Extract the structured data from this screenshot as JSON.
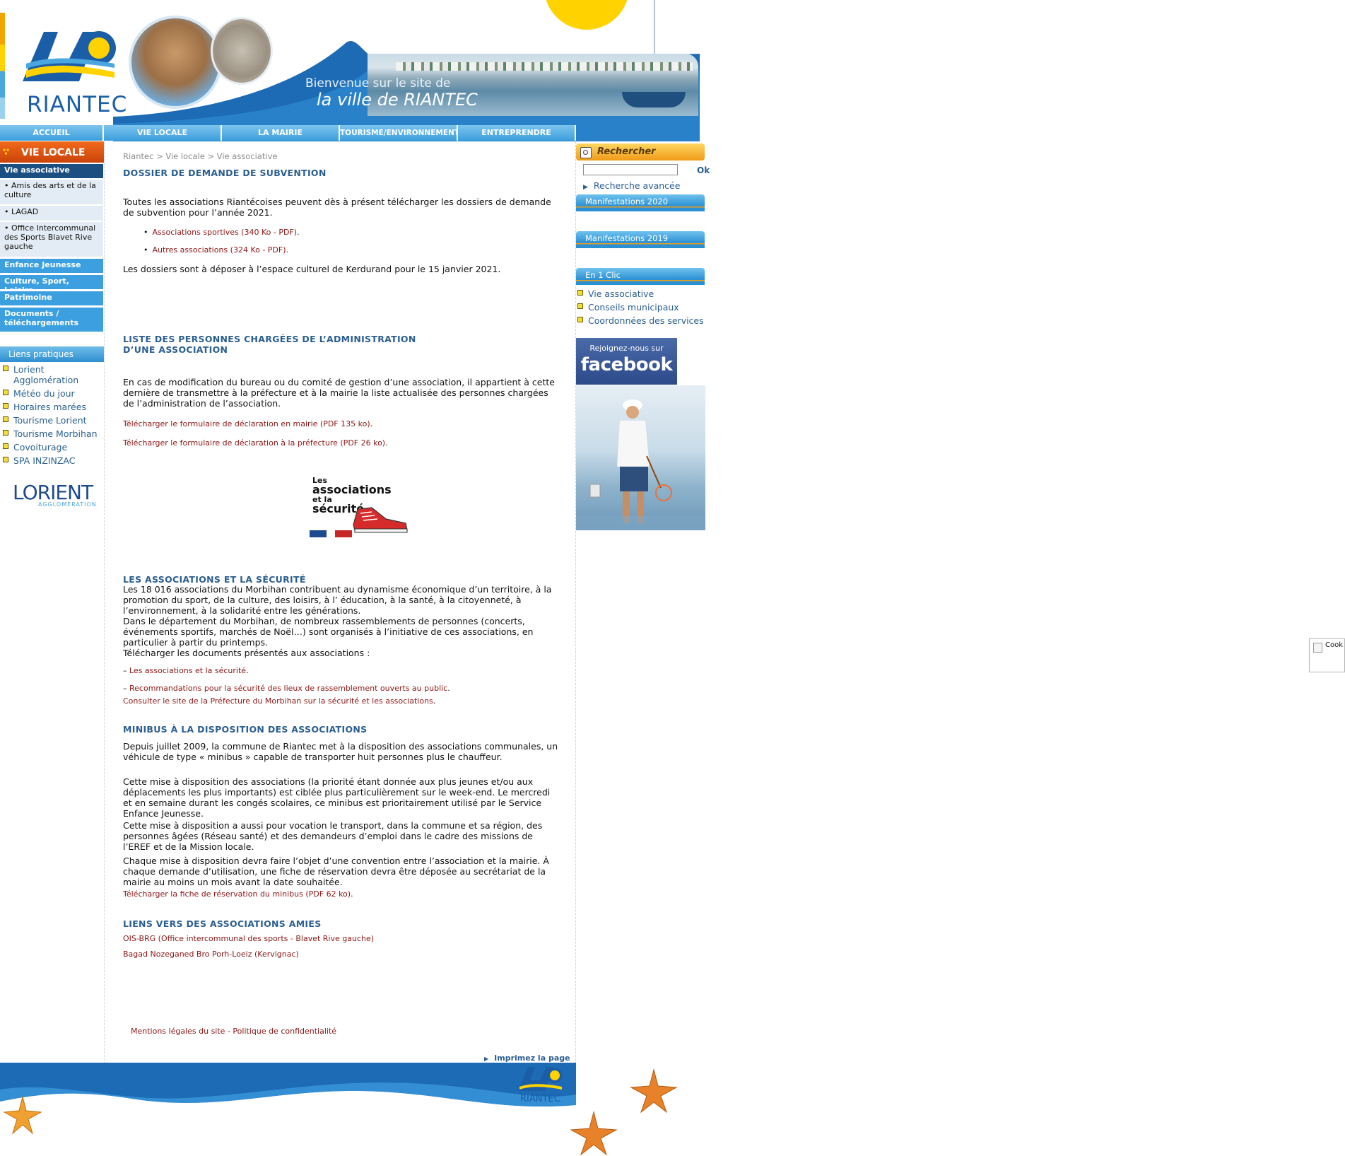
{
  "header": {
    "logo_text": "RIANTEC",
    "welcome_line1": "Bienvenue sur le site de",
    "welcome_line2": "la ville de RIANTEC"
  },
  "nav": {
    "items": [
      "ACCUEIL",
      "VIE LOCALE",
      "LA MAIRIE",
      "TOURISME/ENVIRONNEMENT",
      "ENTREPRENDRE"
    ]
  },
  "left": {
    "section_title": "VIE LOCALE",
    "active_item": "Vie associative",
    "sub_items": [
      "Amis des arts et de la culture",
      "LAGAD",
      "Office Intercommunal des Sports Blavet Rive gauche"
    ],
    "categories": [
      "Enfance Jeunesse",
      "Culture, Sport, Loisirs",
      "Patrimoine",
      "Documents / téléchargements"
    ],
    "liens_title": "Liens pratiques",
    "liens": [
      "Lorient Agglomération",
      "Météo du jour",
      "Horaires marées",
      "Tourisme Lorient",
      "Tourisme Morbihan",
      "Covoiturage",
      "SPA INZINZAC"
    ],
    "partner_logo": "LORIENT",
    "partner_logo_sub": "AGGLOMÉRATION"
  },
  "main": {
    "breadcrumb": "Riantec > Vie locale > Vie associative",
    "s1_title": "DOSSIER DE DEMANDE DE SUBVENTION",
    "s1_p1": "Toutes les associations Riantécoises peuvent dès à présent télécharger les dossiers de demande de subvention pour l’année 2021.",
    "s1_links": [
      "Associations sportives (340 Ko - PDF)",
      "Autres associations (324 Ko - PDF)"
    ],
    "s1_p2": "Les dossiers sont à déposer à l’espace culturel de Kerdurand pour le 15 janvier 2021.",
    "s2_title_l1": "LISTE DES PERSONNES CHARGÉES DE L’ADMINISTRATION",
    "s2_title_l2": "D’UNE ASSOCIATION",
    "s2_p1": "En cas de modification du bureau ou du comité de gestion d’une association, il appartient à cette dernière de transmettre à la préfecture et à la mairie la liste actualisée des personnes chargées de l’administration de l’association.",
    "s2_link1": "Télécharger le formulaire de déclaration en mairie (PDF 135 ko)",
    "s2_link2": "Télécharger le formulaire de déclaration à la préfecture (PDF 26 ko)",
    "secu_img_l1": "Les",
    "secu_img_l2": "associations",
    "secu_img_l3": "et la",
    "secu_img_l4": "sécurité",
    "s3_title": "LES ASSOCIATIONS ET LA SÉCURITÉ",
    "s3_p1": "Les 18 016 associations du Morbihan contribuent au dynamisme économique d’un territoire, à la promotion du sport, de la culture, des loisirs, à l’ éducation, à la santé, à la citoyenneté, à l’environnement, à la solidarité entre les générations.",
    "s3_p2": "Dans le département du Morbihan, de nombreux rassemblements de personnes (concerts, événements sportifs, marchés de Noël…) sont organisés à l’initiative de ces associations, en particulier à partir du printemps.",
    "s3_p3": "Télécharger les documents présentés aux associations :",
    "s3_link1": "Les associations et la sécurité",
    "s3_link2": "Recommandations pour la sécurité des lieux de rassemblement ouverts au public",
    "s3_link3": "Consulter le site de la Préfecture du Morbihan sur la sécurité et les associations",
    "s4_title": "MINIBUS À LA DISPOSITION DES ASSOCIATIONS",
    "s4_p1": "Depuis juillet 2009, la commune de Riantec met à la disposition des associations communales, un véhicule de type « minibus » capable de transporter huit personnes plus le chauffeur.",
    "s4_p2": "Cette mise à disposition des associations (la priorité étant donnée aux plus jeunes et/ou aux déplacements les plus importants) est ciblée plus particulièrement sur le week-end. Le mercredi et en semaine durant les congés scolaires, ce minibus est prioritairement utilisé par le Service Enfance Jeunesse.",
    "s4_p3": "Cette mise à disposition a aussi pour vocation le transport, dans la commune et sa région, des personnes âgées (Réseau santé) et des demandeurs d’emploi dans le cadre des missions de l’EREF et de la Mission locale.",
    "s4_p4": "Chaque mise à disposition devra faire l’objet d’une convention entre l’association et la mairie. À chaque demande d’utilisation, une fiche de réservation devra être déposée au secrétariat de la mairie au moins un mois avant la date souhaitée.",
    "s4_link1": "Télécharger la fiche de réservation du minibus (PDF 62 ko)",
    "s5_title": "LIENS VERS DES ASSOCIATIONS AMIES",
    "s5_link1": "OIS-BRG (Office intercommunal des sports - Blavet Rive gauche)",
    "s5_link2": "Bagad Nozeganed Bro Porh-Loeiz (Kervignac)",
    "footer_link1": "Mentions légales du site",
    "footer_sep": " - ",
    "footer_link2": "Politique de confidentialité",
    "print_label": "Imprimez la page"
  },
  "right": {
    "search_title": "Rechercher",
    "search_value": "",
    "search_ok": "Ok",
    "advanced_search": "Recherche avancée",
    "bars": [
      "Manifestations 2020",
      "Manifestations 2019",
      "En 1 Clic"
    ],
    "clic_links": [
      "Vie associative",
      "Conseils municipaux",
      "Coordonnées des services"
    ],
    "fb_small": "Rejoignez-nous sur",
    "fb_big": "facebook"
  },
  "footer": {
    "logo_text": "RIANTEC"
  },
  "cookie": {
    "label": "Cook"
  },
  "colors": {
    "link_red": "#8b1616",
    "heading_blue": "#2b5e91",
    "nav_blue": "#3c9fdc",
    "accent_orange": "#f26a1b"
  }
}
